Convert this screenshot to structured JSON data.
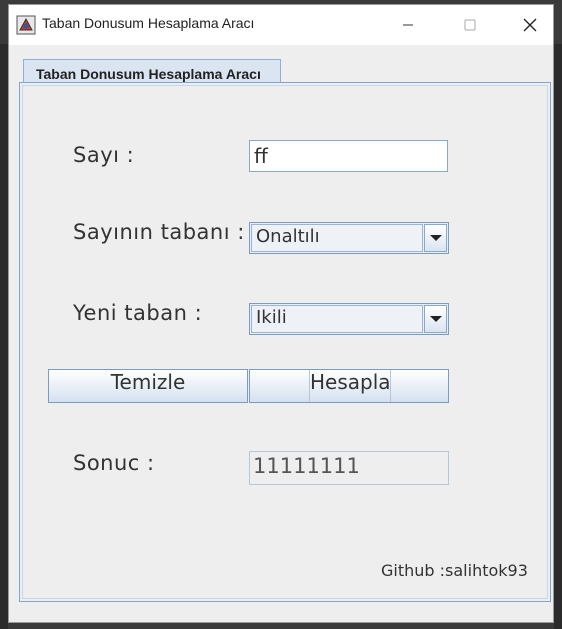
{
  "window": {
    "title": "Taban Donusum Hesaplama Aracı"
  },
  "tab": {
    "label": "Taban Donusum Hesaplama Aracı"
  },
  "form": {
    "number_label": "Sayı :",
    "number_value": "ff",
    "base_label": "Sayının tabanı :",
    "base_value": "Onaltılı",
    "new_base_label": "Yeni taban :",
    "new_base_value": "Ikili",
    "clear_button": "Temizle",
    "calculate_button": "Hesapla",
    "result_label": "Sonuc :",
    "result_value": "11111111"
  },
  "footer": {
    "github": "Github :salihtok93"
  }
}
